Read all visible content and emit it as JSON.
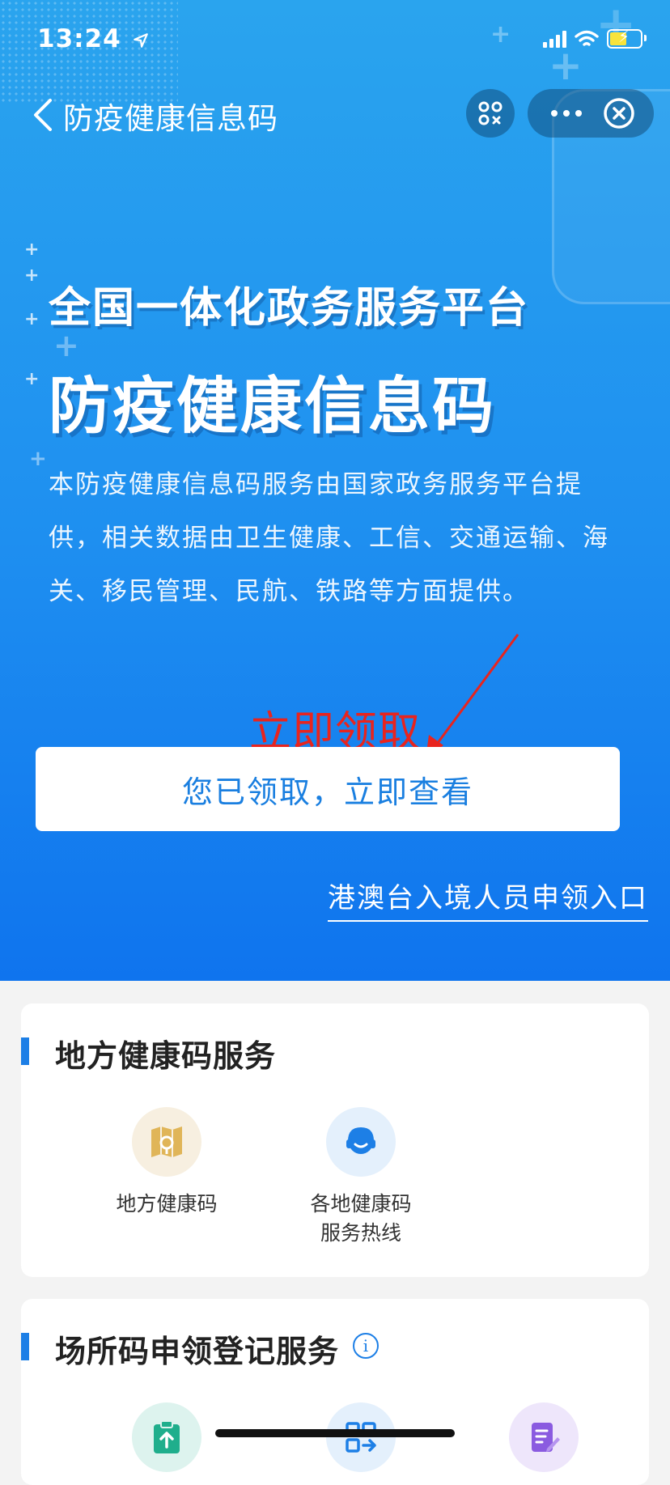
{
  "status_bar": {
    "time": "13:24"
  },
  "nav": {
    "title": "防疫健康信息码"
  },
  "hero": {
    "platform_title": "全国一体化政务服务平台",
    "main_title": "防疫健康信息码",
    "description": "本防疫健康信息码服务由国家政务服务平台提供，相关数据由卫生健康、工信、交通运输、海关、移民管理、民航、铁路等方面提供。",
    "annotation": "立即领取",
    "claim_button": "您已领取，立即查看",
    "hk_link": "港澳台入境人员申领入口"
  },
  "local_services": {
    "title": "地方健康码服务",
    "items": [
      {
        "label": "地方健康码",
        "icon": "map-pin-icon",
        "bg": "#f7efe0",
        "color": "#d9a84a"
      },
      {
        "label_line1": "各地健康码",
        "label_line2": "服务热线",
        "icon": "headset-icon",
        "bg": "#e4f0fc",
        "color": "#1d7fe6"
      }
    ]
  },
  "venue_services": {
    "title": "场所码申领登记服务",
    "items": [
      {
        "icon": "clipboard-upload-icon",
        "bg": "#ddf3ee",
        "color": "#1fae8c"
      },
      {
        "icon": "qr-code-icon",
        "bg": "#e4f0fc",
        "color": "#1d7fe6"
      },
      {
        "icon": "edit-document-icon",
        "bg": "#eee6fb",
        "color": "#8a5be0"
      }
    ]
  },
  "colors": {
    "accent": "#1d7fe6",
    "annotation": "#e8241e"
  }
}
